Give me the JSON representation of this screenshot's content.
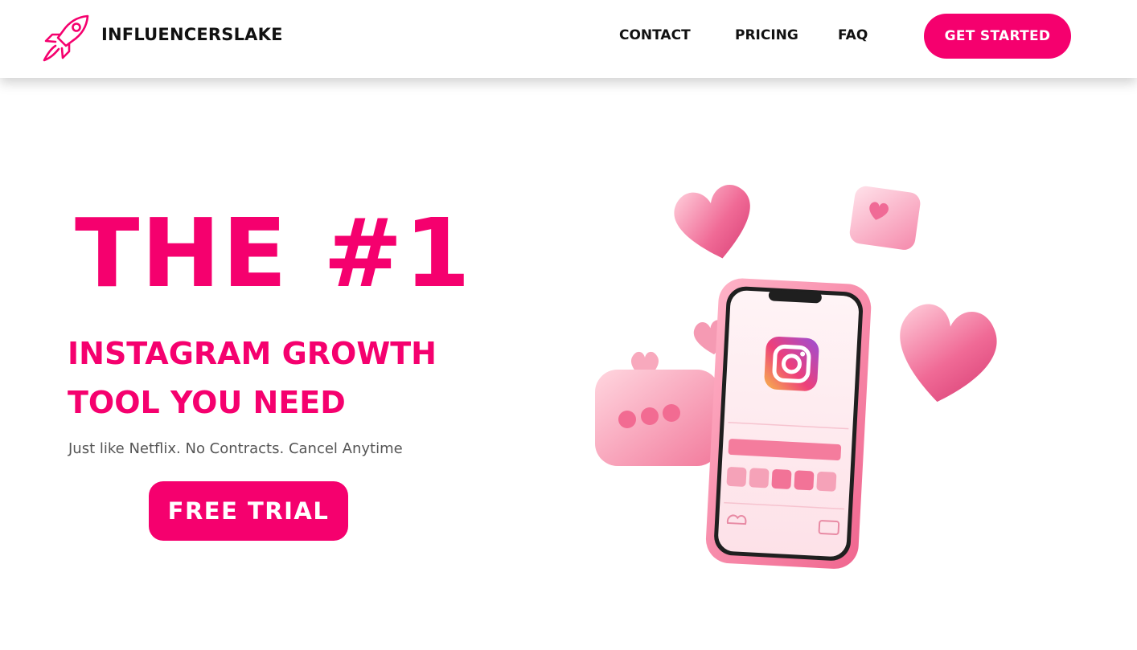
{
  "brand": {
    "name": "INFLUENCERSLAKE",
    "icon": "rocket-icon"
  },
  "nav": {
    "items": [
      {
        "label": "CONTACT"
      },
      {
        "label": "PRICING"
      },
      {
        "label": "FAQ"
      }
    ],
    "cta_label": "GET STARTED"
  },
  "hero": {
    "title": "THE #1",
    "subtitle_line1": "INSTAGRAM GROWTH",
    "subtitle_line2": "TOOL YOU NEED",
    "tagline": "Just like Netflix. No Contracts. Cancel Anytime",
    "cta_label": "FREE TRIAL",
    "illustration": "phone-with-instagram-and-hearts-illustration"
  },
  "colors": {
    "accent": "#f5006e",
    "text_dark": "#111111",
    "text_muted": "#555555",
    "background": "#ffffff"
  }
}
